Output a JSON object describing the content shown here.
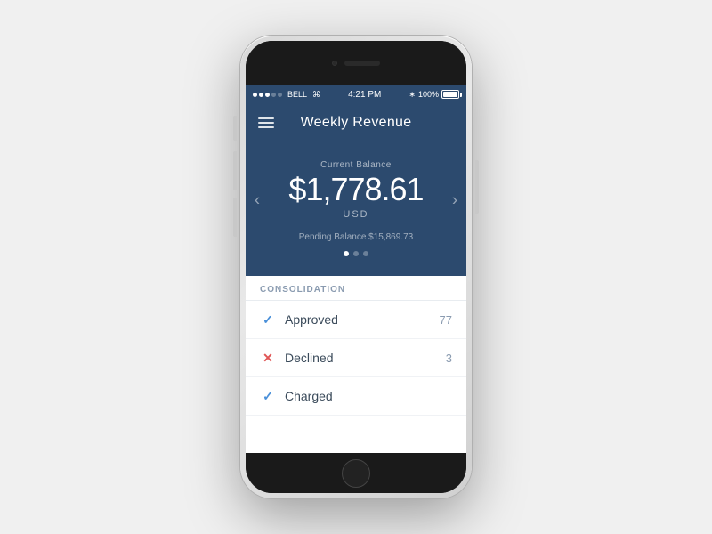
{
  "phone": {
    "statusBar": {
      "signalDots": [
        {
          "filled": true
        },
        {
          "filled": true
        },
        {
          "filled": true
        },
        {
          "filled": false
        },
        {
          "filled": false
        }
      ],
      "carrier": "BELL",
      "wifi": "wifi",
      "time": "4:21 PM",
      "bluetooth": "BT",
      "batteryPercent": "100%"
    },
    "header": {
      "title": "Weekly Revenue",
      "menuIcon": "hamburger-icon"
    },
    "balanceSection": {
      "label": "Current Balance",
      "amount": "$1,778.61",
      "currency": "USD",
      "pendingLabel": "Pending Balance $15,869.73",
      "navLeft": "‹",
      "navRight": "›",
      "pageDots": [
        {
          "active": true
        },
        {
          "active": false
        },
        {
          "active": false
        }
      ]
    },
    "consolidation": {
      "sectionHeader": "CONSOLIDATION",
      "items": [
        {
          "iconType": "check",
          "label": "Approved",
          "count": "77"
        },
        {
          "iconType": "x",
          "label": "Declined",
          "count": "3"
        },
        {
          "iconType": "check",
          "label": "Charged",
          "count": ""
        }
      ]
    }
  }
}
